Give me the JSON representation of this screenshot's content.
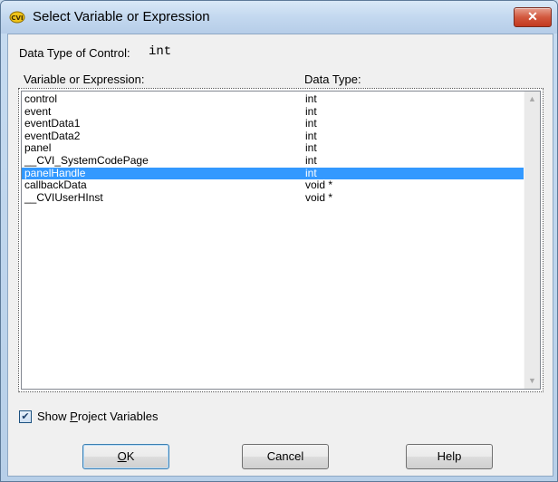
{
  "window": {
    "title": "Select Variable or Expression",
    "close_label": "✕"
  },
  "data_type_of_control": {
    "label": "Data Type of Control:",
    "value": "int"
  },
  "list": {
    "column_variable": "Variable or Expression:",
    "column_type": "Data Type:",
    "selected_index": 6,
    "rows": [
      {
        "name": "control",
        "type": "int"
      },
      {
        "name": "event",
        "type": "int"
      },
      {
        "name": "eventData1",
        "type": "int"
      },
      {
        "name": "eventData2",
        "type": "int"
      },
      {
        "name": "panel",
        "type": "int"
      },
      {
        "name": "__CVI_SystemCodePage",
        "type": "int"
      },
      {
        "name": "panelHandle",
        "type": "int"
      },
      {
        "name": "callbackData",
        "type": "void *"
      },
      {
        "name": "__CVIUserHInst",
        "type": "void *"
      }
    ],
    "scroll_up_icon": "▲",
    "scroll_down_icon": "▼"
  },
  "show_project_variables": {
    "label": "Show Project Variables",
    "checked": true,
    "check_glyph": "✔"
  },
  "buttons": {
    "ok": "OK",
    "cancel": "Cancel",
    "help": "Help"
  },
  "colors": {
    "selection": "#3399ff",
    "close_button": "#c2391f"
  }
}
